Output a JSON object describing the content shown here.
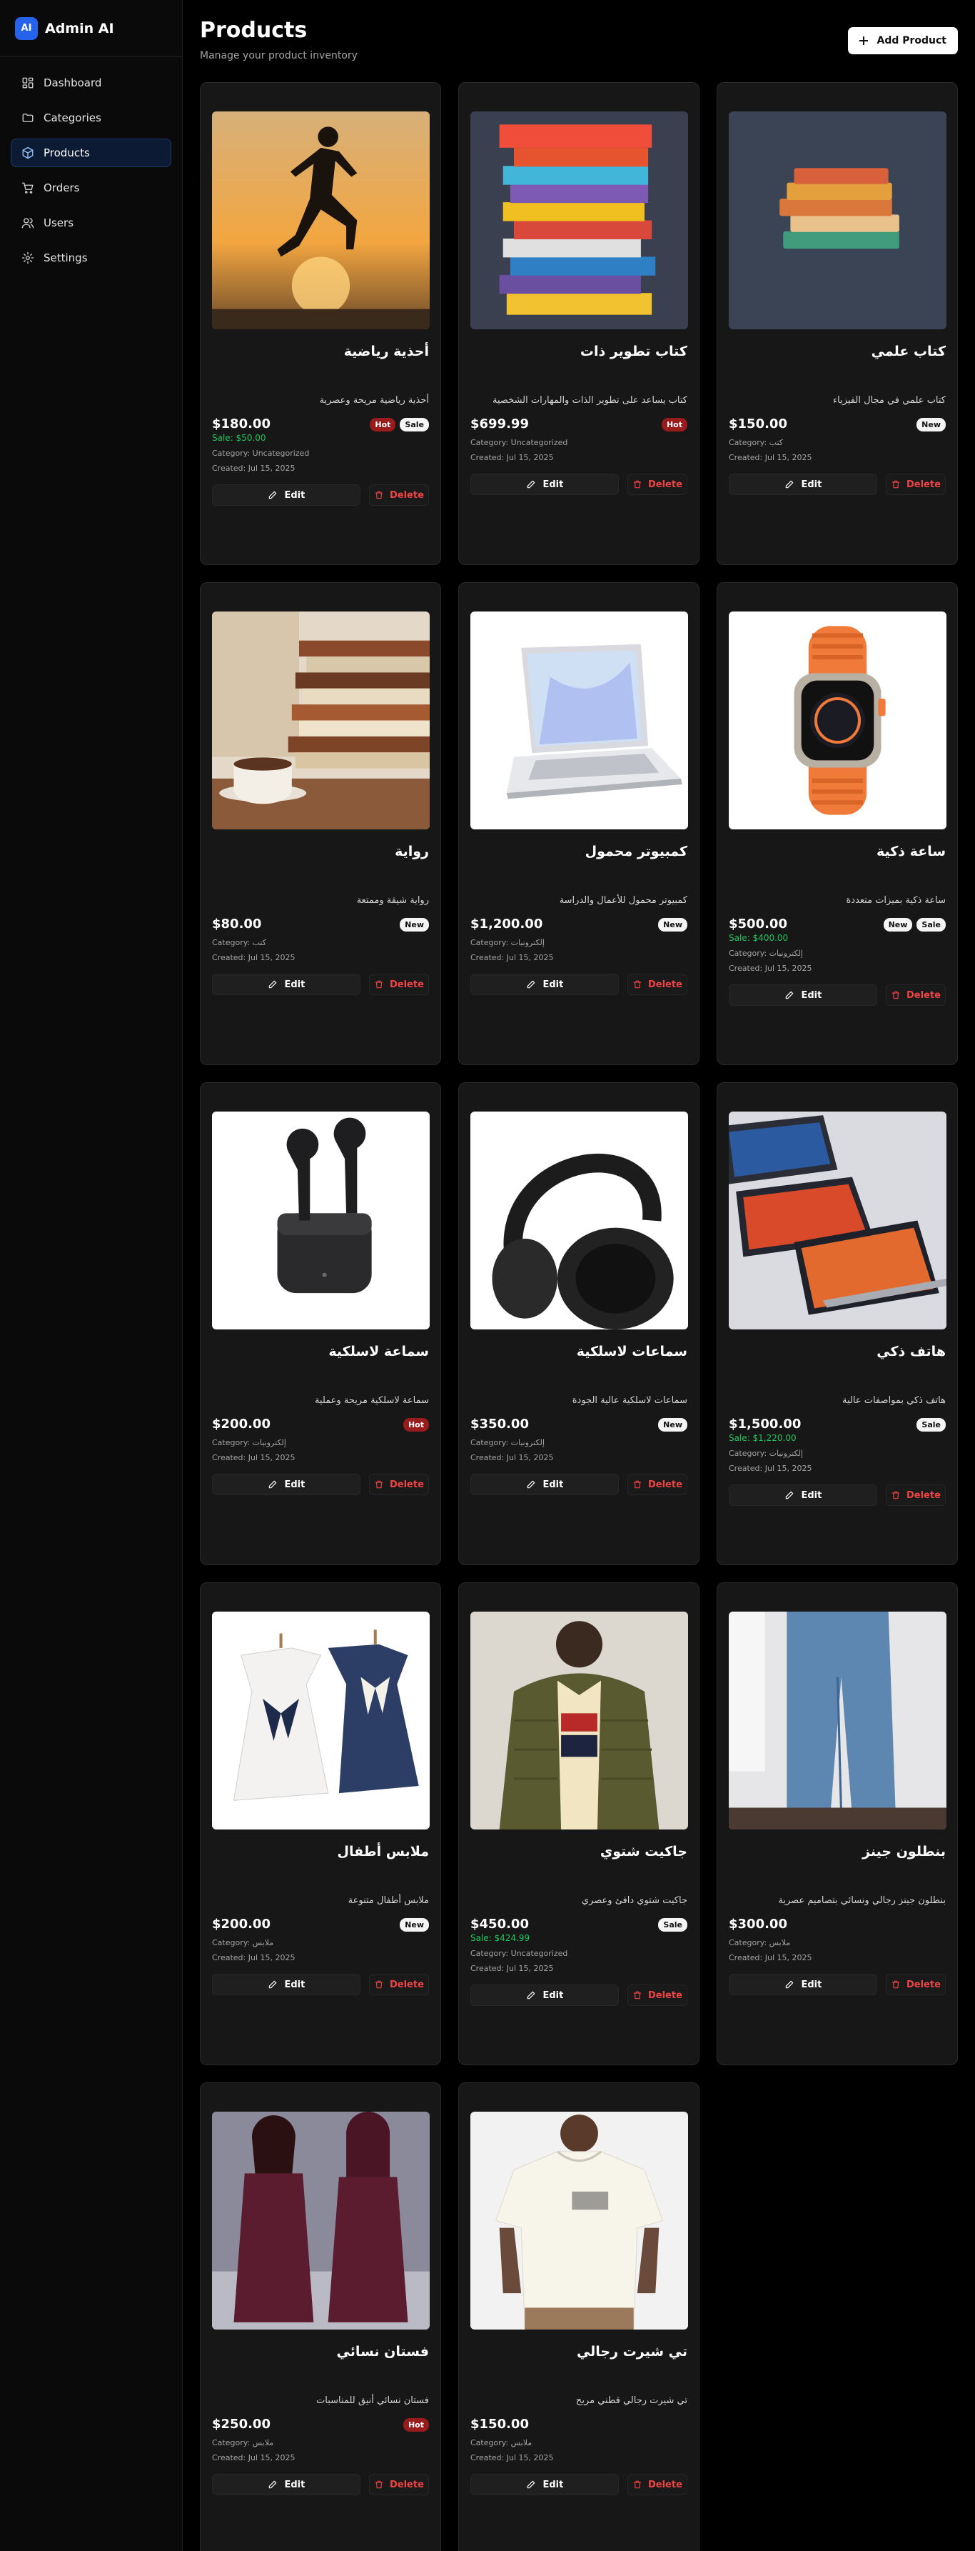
{
  "app": {
    "logo": "AI",
    "name": "Admin AI"
  },
  "sidebar": {
    "items": [
      {
        "label": "Dashboard",
        "icon": "dashboard-icon",
        "active": false
      },
      {
        "label": "Categories",
        "icon": "folder-icon",
        "active": false
      },
      {
        "label": "Products",
        "icon": "box-icon",
        "active": true
      },
      {
        "label": "Orders",
        "icon": "cart-icon",
        "active": false
      },
      {
        "label": "Users",
        "icon": "users-icon",
        "active": false
      },
      {
        "label": "Settings",
        "icon": "gear-icon",
        "active": false
      }
    ]
  },
  "header": {
    "title": "Products",
    "subtitle": "Manage your product inventory",
    "add_label": "Add Product"
  },
  "labels": {
    "edit": "Edit",
    "delete": "Delete"
  },
  "colors": {
    "accent": "#2563eb",
    "hot": "#991b1b",
    "sale_green": "#22c55e",
    "delete_red": "#ef4444"
  },
  "products": [
    {
      "name": "أحذية رياضية",
      "description": "أحذية رياضية مريحة وعصرية",
      "price": "$180.00",
      "sale": "Sale: $50.00",
      "badges": [
        "Hot",
        "Sale"
      ],
      "category": "Category: Uncategorized",
      "created": "Created: Jul 15, 2025",
      "image": "runner"
    },
    {
      "name": "كتاب تطوير ذات",
      "description": "كتاب يساعد على تطوير الذات والمهارات الشخصية",
      "price": "$699.99",
      "sale": "",
      "badges": [
        "Hot"
      ],
      "category": "Category: Uncategorized",
      "created": "Created: Jul 15, 2025",
      "image": "books-stack"
    },
    {
      "name": "كتاب علمي",
      "description": "كتاب علمي في مجال الفيزياء",
      "price": "$150.00",
      "sale": "",
      "badges": [
        "New"
      ],
      "category": "Category: كتب",
      "created": "Created: Jul 15, 2025",
      "image": "books-small"
    },
    {
      "name": "رواية",
      "description": "رواية شيقة وممتعة",
      "price": "$80.00",
      "sale": "",
      "badges": [
        "New"
      ],
      "category": "Category: كتب",
      "created": "Created: Jul 15, 2025",
      "image": "books-cup"
    },
    {
      "name": "كمبيوتر محمول",
      "description": "كمبيوتر محمول للأعمال والدراسة",
      "price": "$1,200.00",
      "sale": "",
      "badges": [
        "New"
      ],
      "category": "Category: إلكترونيات",
      "created": "Created: Jul 15, 2025",
      "image": "laptop"
    },
    {
      "name": "ساعة ذكية",
      "description": "ساعة ذكية بميزات متعددة",
      "price": "$500.00",
      "sale": "Sale: $400.00",
      "badges": [
        "New",
        "Sale"
      ],
      "category": "Category: إلكترونيات",
      "created": "Created: Jul 15, 2025",
      "image": "watch"
    },
    {
      "name": "سماعة لاسلكية",
      "description": "سماعة لاسلكية مريحة وعملية",
      "price": "$200.00",
      "sale": "",
      "badges": [
        "Hot"
      ],
      "category": "Category: إلكترونيات",
      "created": "Created: Jul 15, 2025",
      "image": "earbuds"
    },
    {
      "name": "سماعات لاسلكية",
      "description": "سماعات لاسلكية عالية الجودة",
      "price": "$350.00",
      "sale": "",
      "badges": [
        "New"
      ],
      "category": "Category: إلكترونيات",
      "created": "Created: Jul 15, 2025",
      "image": "headphones"
    },
    {
      "name": "هاتف ذكي",
      "description": "هاتف ذكي بمواصفات عالية",
      "price": "$1,500.00",
      "sale": "Sale: $1,220.00",
      "badges": [
        "Sale"
      ],
      "category": "Category: إلكترونيات",
      "created": "Created: Jul 15, 2025",
      "image": "tablets"
    },
    {
      "name": "ملابس أطفال",
      "description": "ملابس أطفال متنوعة",
      "price": "$200.00",
      "sale": "",
      "badges": [
        "New"
      ],
      "category": "Category: ملابس",
      "created": "Created: Jul 15, 2025",
      "image": "kids-dresses"
    },
    {
      "name": "جاكيت شتوي",
      "description": "جاكيت شتوي دافئ وعصري",
      "price": "$450.00",
      "sale": "Sale: $424.99",
      "badges": [
        "Sale"
      ],
      "category": "Category: Uncategorized",
      "created": "Created: Jul 15, 2025",
      "image": "jacket"
    },
    {
      "name": "بنطلون جينز",
      "description": "بنطلون جينز رجالي ونسائي بتصاميم عصرية",
      "price": "$300.00",
      "sale": "",
      "badges": [],
      "category": "Category: ملابس",
      "created": "Created: Jul 15, 2025",
      "image": "jeans"
    },
    {
      "name": "فستان نسائي",
      "description": "فستان نسائي أنيق للمناسبات",
      "price": "$250.00",
      "sale": "",
      "badges": [
        "Hot"
      ],
      "category": "Category: ملابس",
      "created": "Created: Jul 15, 2025",
      "image": "coat"
    },
    {
      "name": "تي شيرت رجالي",
      "description": "تي شيرت رجالي قطني مريح",
      "price": "$150.00",
      "sale": "",
      "badges": [],
      "category": "Category: ملابس",
      "created": "Created: Jul 15, 2025",
      "image": "tshirt"
    }
  ]
}
